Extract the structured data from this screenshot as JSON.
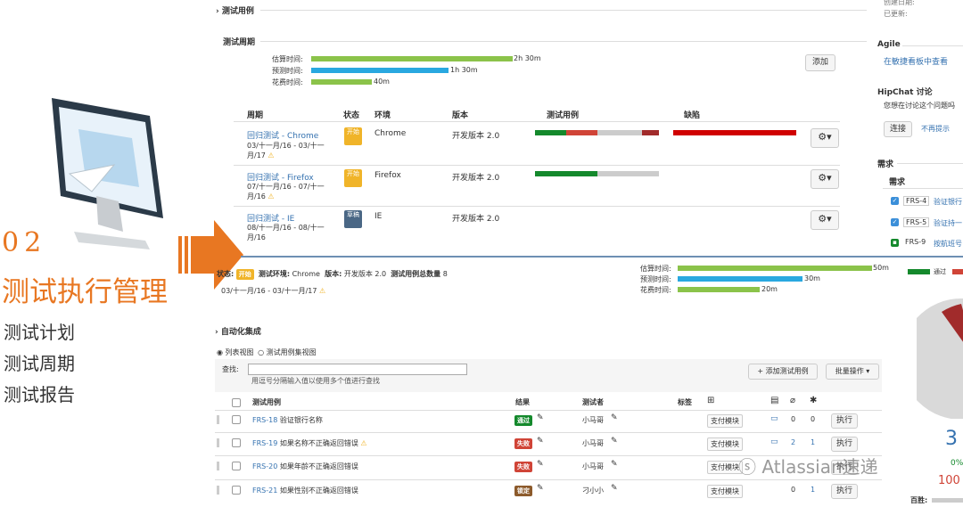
{
  "slide": {
    "number": "02",
    "title": "测试执行管理",
    "bullets": [
      "测试计划",
      "测试周期",
      "测试报告"
    ]
  },
  "top_panel": {
    "test_cases_heading": "测试用例",
    "cycles_heading": "测试周期",
    "time": [
      {
        "label": "估算时间:",
        "value": "2h 30m",
        "color": "#8bc34a",
        "fraction": 1.0
      },
      {
        "label": "预测时间:",
        "value": "1h 30m",
        "color": "#29a8e0",
        "fraction": 0.6
      },
      {
        "label": "花费时间:",
        "value": "40m",
        "color": "#8bc34a",
        "fraction": 0.3
      }
    ],
    "add_button": "添加",
    "columns": [
      "周期",
      "状态",
      "环境",
      "版本",
      "测试用例",
      "缺陷"
    ],
    "rows": [
      {
        "name": "回归测试 - Chrome",
        "dates": "03/十一月/16 - 03/十一月/17",
        "status": "开始",
        "status_color": "#f0b429",
        "env": "Chrome",
        "version": "开发版本 2.0",
        "warn": true
      },
      {
        "name": "回归测试 - Firefox",
        "dates": "07/十一月/16 - 07/十一月/16",
        "status": "开始",
        "status_color": "#f0b429",
        "env": "Firefox",
        "version": "开发版本 2.0",
        "warn": true
      },
      {
        "name": "回归测试 - IE",
        "dates": "08/十一月/16 - 08/十一月/16",
        "status": "草稿",
        "status_color": "#4a6785",
        "env": "IE",
        "version": "开发版本 2.0",
        "warn": false
      }
    ]
  },
  "right_panel": {
    "created_label": "创建日期:",
    "updated_label": "已更新:",
    "agile_heading": "Agile",
    "agile_link": "在敏捷看板中查看",
    "hipchat_heading": "HipChat 讨论",
    "hipchat_text": "您想在讨论这个问题吗",
    "connect_button": "连接",
    "dismiss_link": "不再提示",
    "req_heading": "需求",
    "req_subheading": "需求",
    "req_items": [
      {
        "key": "FRS-4",
        "text": "验证银行"
      },
      {
        "key": "FRS-5",
        "text": "验证持一"
      },
      {
        "key": "FRS-9",
        "text": "按航班号"
      }
    ]
  },
  "bottom_panel": {
    "status_label": "状态:",
    "status": "开始",
    "env_label": "测试环境:",
    "env": "Chrome",
    "version_label": "版本:",
    "version": "开发版本 2.0",
    "count_label": "测试用例总数量",
    "count": "8",
    "dates": "03/十一月/16 - 03/十一月/17",
    "time": [
      {
        "label": "估算时间:",
        "value": "50m",
        "color": "#8bc34a",
        "fraction": 1.0
      },
      {
        "label": "预测时间:",
        "value": "30m",
        "color": "#29a8e0",
        "fraction": 0.63
      },
      {
        "label": "花费时间:",
        "value": "20m",
        "color": "#8bc34a",
        "fraction": 0.42
      }
    ],
    "legend_pass": "通过",
    "automation_heading": "自动化集成",
    "view_list": "列表视图",
    "view_set": "测试用例集视图",
    "search_label": "查找:",
    "search_hint": "用逗号分隔输入值以使用多个值进行查找",
    "add_case_button": "+ 添加测试用例",
    "bulk_button": "批量操作 ▾",
    "columns": [
      "测试用例",
      "结果",
      "测试者",
      "标签"
    ],
    "rows": [
      {
        "key": "FRS-18",
        "title": "验证银行名称",
        "warn": false,
        "result": "通过",
        "result_color": "#14892c",
        "tester": "小马哥",
        "component": "支付模块",
        "comments": "0",
        "attachments": "0",
        "defects": "",
        "comment_icon": true
      },
      {
        "key": "FRS-19",
        "title": "如果名称不正确返回错误",
        "warn": true,
        "result": "失败",
        "result_color": "#d04437",
        "tester": "小马哥",
        "component": "支付模块",
        "comments": "2",
        "attachments": "1",
        "defects": "",
        "comment_icon": true
      },
      {
        "key": "FRS-20",
        "title": "如果年龄不正确返回错误",
        "warn": false,
        "result": "失败",
        "result_color": "#d04437",
        "tester": "小马哥",
        "component": "支付模块",
        "comments": "",
        "attachments": "",
        "defects": "",
        "comment_icon": false
      },
      {
        "key": "FRS-21",
        "title": "如果性别不正确返回错误",
        "warn": false,
        "result": "锁定",
        "result_color": "#8c5a2b",
        "tester": "刁小小",
        "component": "支付模块",
        "comments": "",
        "attachments": "0",
        "defects": "1",
        "comment_icon": false
      }
    ],
    "execute_button": "执行",
    "pie_number": "3",
    "pie_pct1": "0%",
    "pie_pct2": "100",
    "pie_footer": "百胜:"
  },
  "watermark": "Atlassian速递",
  "colors": {
    "green": "#14892c",
    "red": "#d04437",
    "gray": "#cccccc",
    "blue": "#29a8e0",
    "orange": "#e87722"
  }
}
